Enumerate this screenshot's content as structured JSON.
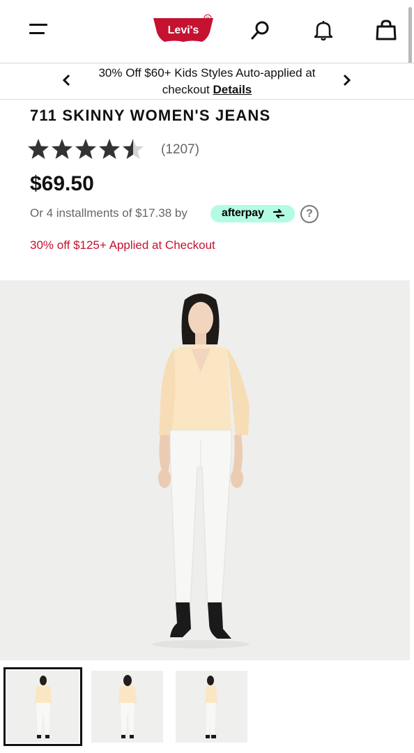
{
  "header": {
    "logo_text": "Levi's",
    "menu_icon": "hamburger-menu-icon",
    "search_icon": "search-icon",
    "notification_icon": "bell-icon",
    "bag_icon": "shopping-bag-icon",
    "brand_color": "#c41230"
  },
  "promo": {
    "text": "30% Off $60+ Kids Styles Auto-applied at checkout",
    "link": "Details",
    "prev_icon": "chevron-left-icon",
    "next_icon": "chevron-right-icon"
  },
  "product": {
    "title": "711 SKINNY WOMEN'S JEANS",
    "rating": 4.5,
    "rating_max": 5,
    "review_count": "(1207)",
    "price": "$69.50",
    "installments": "Or 4 installments of $17.38 by",
    "afterpay_label": "afterpay",
    "afterpay_color": "#b2fce4",
    "help_icon": "question-mark-icon",
    "help_text": "?",
    "discount_text": "30% off $125+ Applied at Checkout",
    "discount_color": "#c41230"
  },
  "gallery": {
    "thumbnails": [
      {
        "view": "front",
        "selected": true
      },
      {
        "view": "back",
        "selected": false
      },
      {
        "view": "side",
        "selected": false
      }
    ]
  }
}
